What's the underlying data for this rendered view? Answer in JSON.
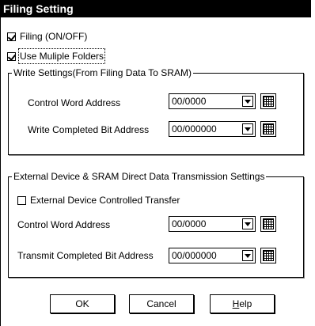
{
  "dialog": {
    "title": "Filing Setting"
  },
  "options": {
    "filing": {
      "label": "Filing (ON/OFF)",
      "checked": true
    },
    "multiple_folders": {
      "label": "Use Muliple Folders",
      "checked": true
    }
  },
  "write_settings": {
    "title": "Write Settings(From Filing Data To SRAM)",
    "control_word_label": "Control Word Address",
    "control_word_value": "00/0000",
    "completed_bit_label": "Write Completed Bit Address",
    "completed_bit_value": "00/000000"
  },
  "external_settings": {
    "title": "External Device & SRAM Direct Data Transmission Settings",
    "controlled_transfer": {
      "label": "External Device Controlled Transfer",
      "checked": false
    },
    "control_word_label": "Control Word Address",
    "control_word_value": "00/0000",
    "transmit_bit_label": "Transmit Completed Bit Address",
    "transmit_bit_value": "00/000000"
  },
  "buttons": {
    "ok": "OK",
    "cancel": "Cancel",
    "help_prefix": "",
    "help_mnemonic": "H",
    "help_rest": "elp"
  }
}
